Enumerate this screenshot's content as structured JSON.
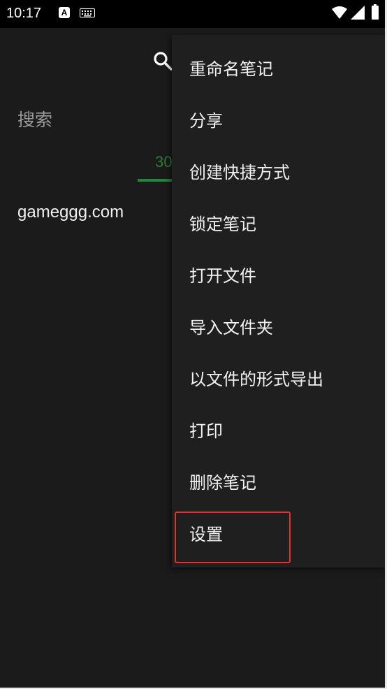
{
  "status_bar": {
    "time": "10:17",
    "icons": [
      "a-notification-icon",
      "keyboard-icon",
      "wifi-icon",
      "signal-icon",
      "battery-icon"
    ],
    "a_icon_letter": "A"
  },
  "app": {
    "search_label": "搜索",
    "tab_label": "30",
    "note_item": "gameggg.com",
    "accent_color": "#1f8a3a"
  },
  "menu": {
    "items": [
      {
        "label": "重命名笔记"
      },
      {
        "label": "分享"
      },
      {
        "label": "创建快捷方式"
      },
      {
        "label": "锁定笔记"
      },
      {
        "label": "打开文件"
      },
      {
        "label": "导入文件夹"
      },
      {
        "label": "以文件的形式导出"
      },
      {
        "label": "打印"
      },
      {
        "label": "删除笔记"
      },
      {
        "label": "设置"
      }
    ],
    "highlighted_item": "设置",
    "highlight_color": "#e5302f"
  }
}
